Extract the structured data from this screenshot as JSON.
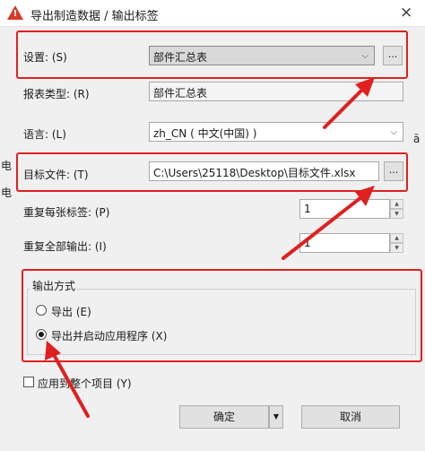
{
  "window": {
    "title": "导出制造数据 / 输出标签",
    "close": "×"
  },
  "fields": {
    "settings_label": "设置: (S)",
    "settings_value": "部件汇总表",
    "report_type_label": "报表类型: (R)",
    "report_type_value": "部件汇总表",
    "language_label": "语言: (L)",
    "language_value": "zh_CN ( 中文(中国) )",
    "target_file_label": "目标文件: (T)",
    "target_file_value": "C:\\Users\\25118\\Desktop\\目标文件.xlsx",
    "repeat_each_label": "重复每张标签: (P)",
    "repeat_each_value": "1",
    "repeat_all_label": "重复全部输出: (I)",
    "repeat_all_value": "1",
    "browse": "..."
  },
  "output_group": {
    "title": "输出方式",
    "option_export": "导出 (E)",
    "option_export_launch": "导出并启动应用程序 (X)",
    "selected": "option_export_launch"
  },
  "apply_all": {
    "label": "应用到整个项目 (Y)",
    "checked": false
  },
  "buttons": {
    "ok": "确定",
    "cancel": "取消"
  },
  "icons": {
    "combo_arrow": "⌵",
    "spin_up": "▲",
    "spin_down": "▼",
    "split_arrow": "▼"
  },
  "colors": {
    "highlight": "#e02020"
  }
}
